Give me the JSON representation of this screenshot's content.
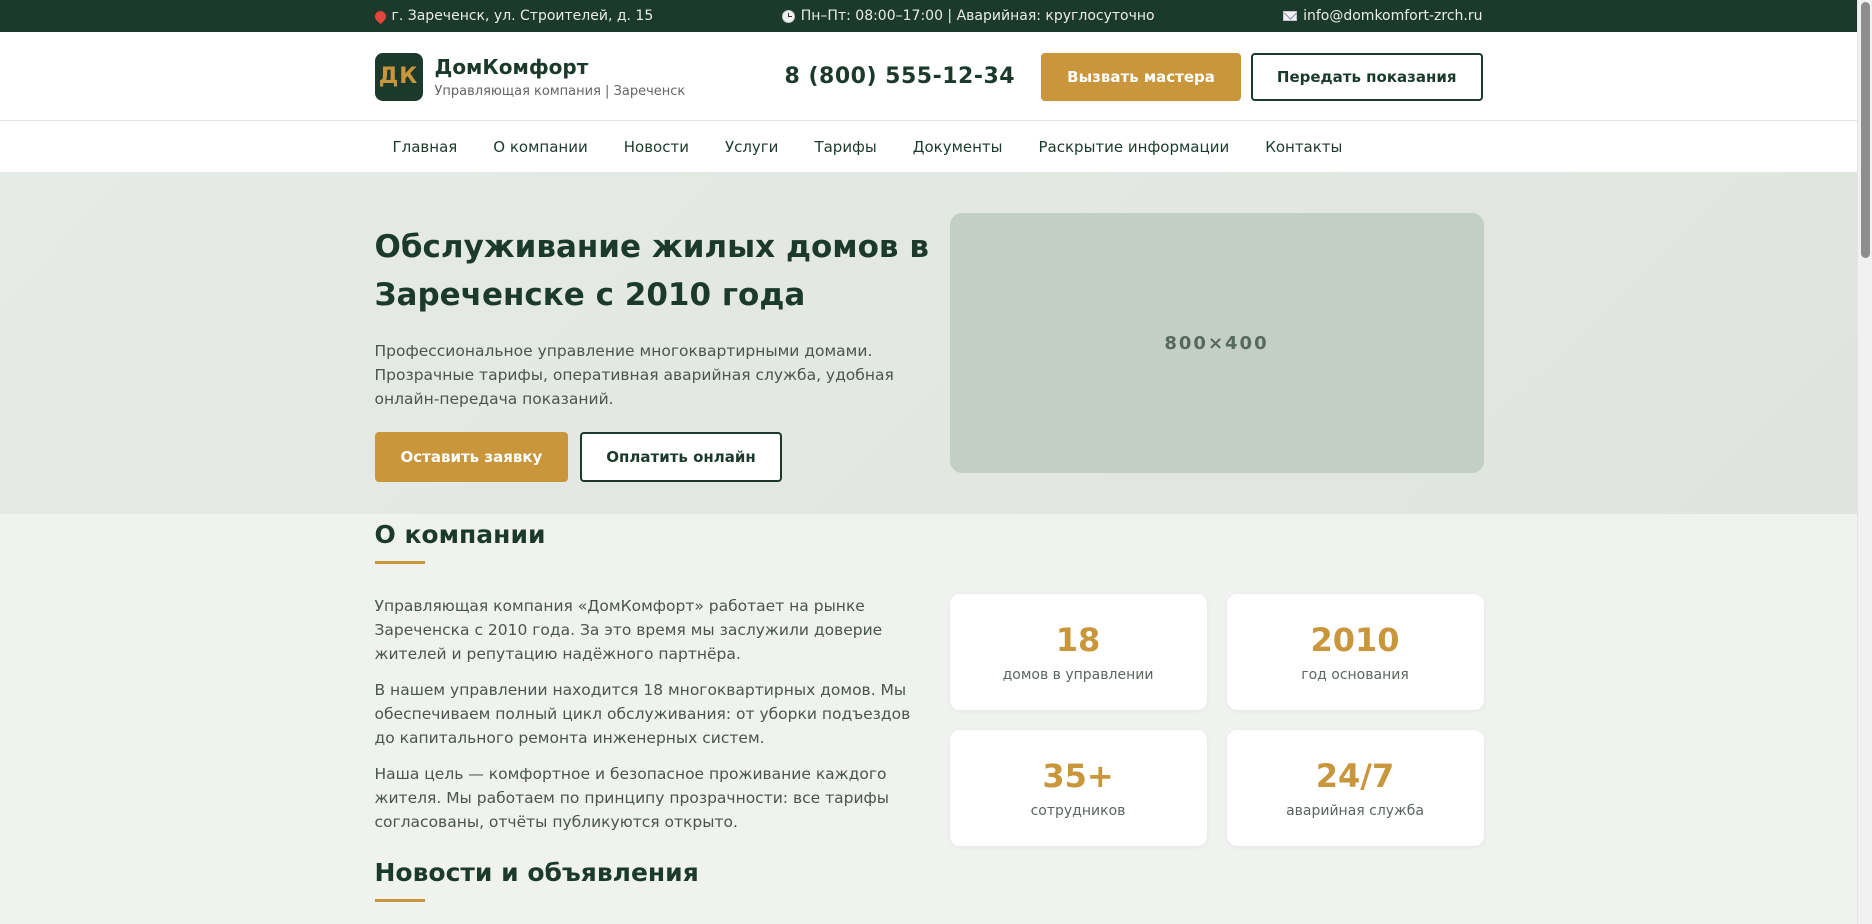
{
  "topbar": {
    "address": "г. Зареченск, ул. Строителей, д. 15",
    "hours": "Пн–Пт: 08:00–17:00 | Аварийная: круглосуточно",
    "email": "info@domkomfort-zrch.ru"
  },
  "header": {
    "logo_text": "ДК",
    "brand_name": "ДомКомфорт",
    "brand_sub": "Управляющая компания | Зареченск",
    "phone": "8 (800) 555-12-34",
    "call_master_label": "Вызвать мастера",
    "submit_readings_label": "Передать показания"
  },
  "nav": {
    "items": [
      "Главная",
      "О компании",
      "Новости",
      "Услуги",
      "Тарифы",
      "Документы",
      "Раскрытие информации",
      "Контакты"
    ]
  },
  "hero": {
    "title": "Обслуживание жилых домов в Зареченске с 2010 года",
    "description": "Профессиональное управление многоквартирными домами. Прозрачные тарифы, оперативная аварийная служба, удобная онлайн-передача показаний.",
    "primary_button": "Оставить заявку",
    "secondary_button": "Оплатить онлайн",
    "image_placeholder": "800×400"
  },
  "about": {
    "title": "О компании",
    "paragraphs": [
      "Управляющая компания «ДомКомфорт» работает на рынке Зареченска с 2010 года. За это время мы заслужили доверие жителей и репутацию надёжного партнёра.",
      "В нашем управлении находится 18 многоквартирных домов. Мы обеспечиваем полный цикл обслуживания: от уборки подъездов до капитального ремонта инженерных систем.",
      "Наша цель — комфортное и безопасное проживание каждого жителя. Мы работаем по принципу прозрачности: все тарифы согласованы, отчёты публикуются открыто."
    ],
    "stats": [
      {
        "value": "18",
        "label": "домов в управлении"
      },
      {
        "value": "2010",
        "label": "год основания"
      },
      {
        "value": "35+",
        "label": "сотрудников"
      },
      {
        "value": "24/7",
        "label": "аварийная служба"
      }
    ]
  },
  "news": {
    "title": "Новости и объявления"
  },
  "colors": {
    "primary": "#1c3a2c",
    "accent": "#c9963c",
    "background": "#f0f2f0"
  }
}
